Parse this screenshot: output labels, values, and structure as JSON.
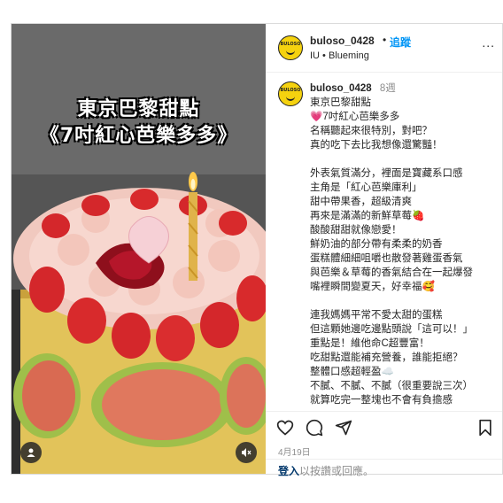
{
  "header": {
    "username": "buloso_0428",
    "separator": "•",
    "follow_label": "追蹤",
    "subtitle": "IU • Blueming",
    "more_label": "...",
    "avatar_logo_text": "BULOSO"
  },
  "media": {
    "title_line1": "東京巴黎甜點",
    "title_line2": "《7吋紅心芭樂多多》"
  },
  "caption": {
    "username": "buloso_0428",
    "time_ago": "8週",
    "lines": [
      "東京巴黎甜點",
      "💗7吋紅心芭樂多多",
      "名稱聽起來很特別，對吧？",
      "真的吃下去比我想像還驚豔！",
      "",
      "外表氣質滿分，裡面是寶藏系口感",
      "主角是「紅心芭樂庫利」",
      "甜中帶果香，超級清爽",
      "再來是滿滿的新鮮草莓🍓",
      "酸酸甜甜就像戀愛！",
      "鮮奶油的部分帶有柔柔的奶香",
      "蛋糕體細細咀嚼也散發著雞蛋香氣",
      "與芭樂＆草莓的香氣結合在一起爆發",
      "嘴裡瞬間變夏天，好幸福🥰",
      "",
      "連我媽媽平常不愛太甜的蛋糕",
      "但這顆她邊吃邊點頭說「這可以！」",
      "重點是！維他命C超豐富！",
      "吃甜點還能補充營養，誰能拒絕？",
      "整體口感超輕盈☁️",
      "不膩、不膩、不膩（很重要說三次）",
      "就算吃完一整塊也不會有負擔感"
    ]
  },
  "actions": {
    "like_icon": "heart-icon",
    "comment_icon": "comment-icon",
    "share_icon": "share-icon",
    "save_icon": "bookmark-icon"
  },
  "date": "4月19日",
  "login": {
    "link_label": "登入",
    "rest_text": "以按讚或回應。"
  }
}
